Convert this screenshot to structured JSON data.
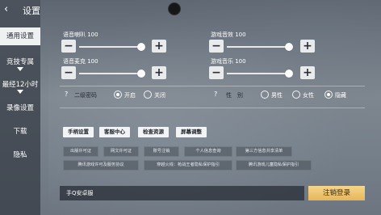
{
  "header": {
    "back_icon": "back-arrow-icon",
    "title": "设置"
  },
  "sidebar": {
    "items": [
      {
        "label": "通用设置",
        "active": true,
        "has_arrow": false
      },
      {
        "label": "竞技专属",
        "active": false,
        "has_arrow": true
      },
      {
        "label": "最经12小时",
        "active": false,
        "has_arrow": true
      },
      {
        "label": "录像设置",
        "active": false,
        "has_arrow": false
      },
      {
        "label": "下载",
        "active": false,
        "has_arrow": false
      },
      {
        "label": "隐私",
        "active": false,
        "has_arrow": false
      }
    ]
  },
  "volume": {
    "sliders": [
      {
        "label": "语音喇叭 100",
        "value": 100,
        "minus": "−",
        "plus": "+"
      },
      {
        "label": "游戏音效 100",
        "value": 100,
        "minus": "−",
        "plus": "+"
      },
      {
        "label": "语音麦克 100",
        "value": 100,
        "minus": "−",
        "plus": "+"
      },
      {
        "label": "游戏音乐 100",
        "value": 100,
        "minus": "−",
        "plus": "+"
      }
    ]
  },
  "options": {
    "password": {
      "help": "?",
      "label": "二级密码",
      "on": "开启",
      "off": "关闭",
      "selected": "on"
    },
    "gender": {
      "help": "?",
      "label": "性　别",
      "male": "男性",
      "female": "女性",
      "hidden": "隐藏",
      "selected": "hidden"
    }
  },
  "actions": [
    "手柄设置",
    "客服中心",
    "检查资源",
    "屏幕调整"
  ],
  "links": {
    "row1": [
      "出版许可证",
      "网文许可证",
      "账号注销",
      "个人信息查询",
      "第三方信息共享清单"
    ],
    "row2": [
      "腾讯游戏许可及服务协议",
      "穿越火线：枪战王者隐私保护指引",
      "腾讯游戏儿童隐私保护指引"
    ]
  },
  "footer": {
    "platform": "手Q安卓服",
    "logout": "注销登录"
  }
}
